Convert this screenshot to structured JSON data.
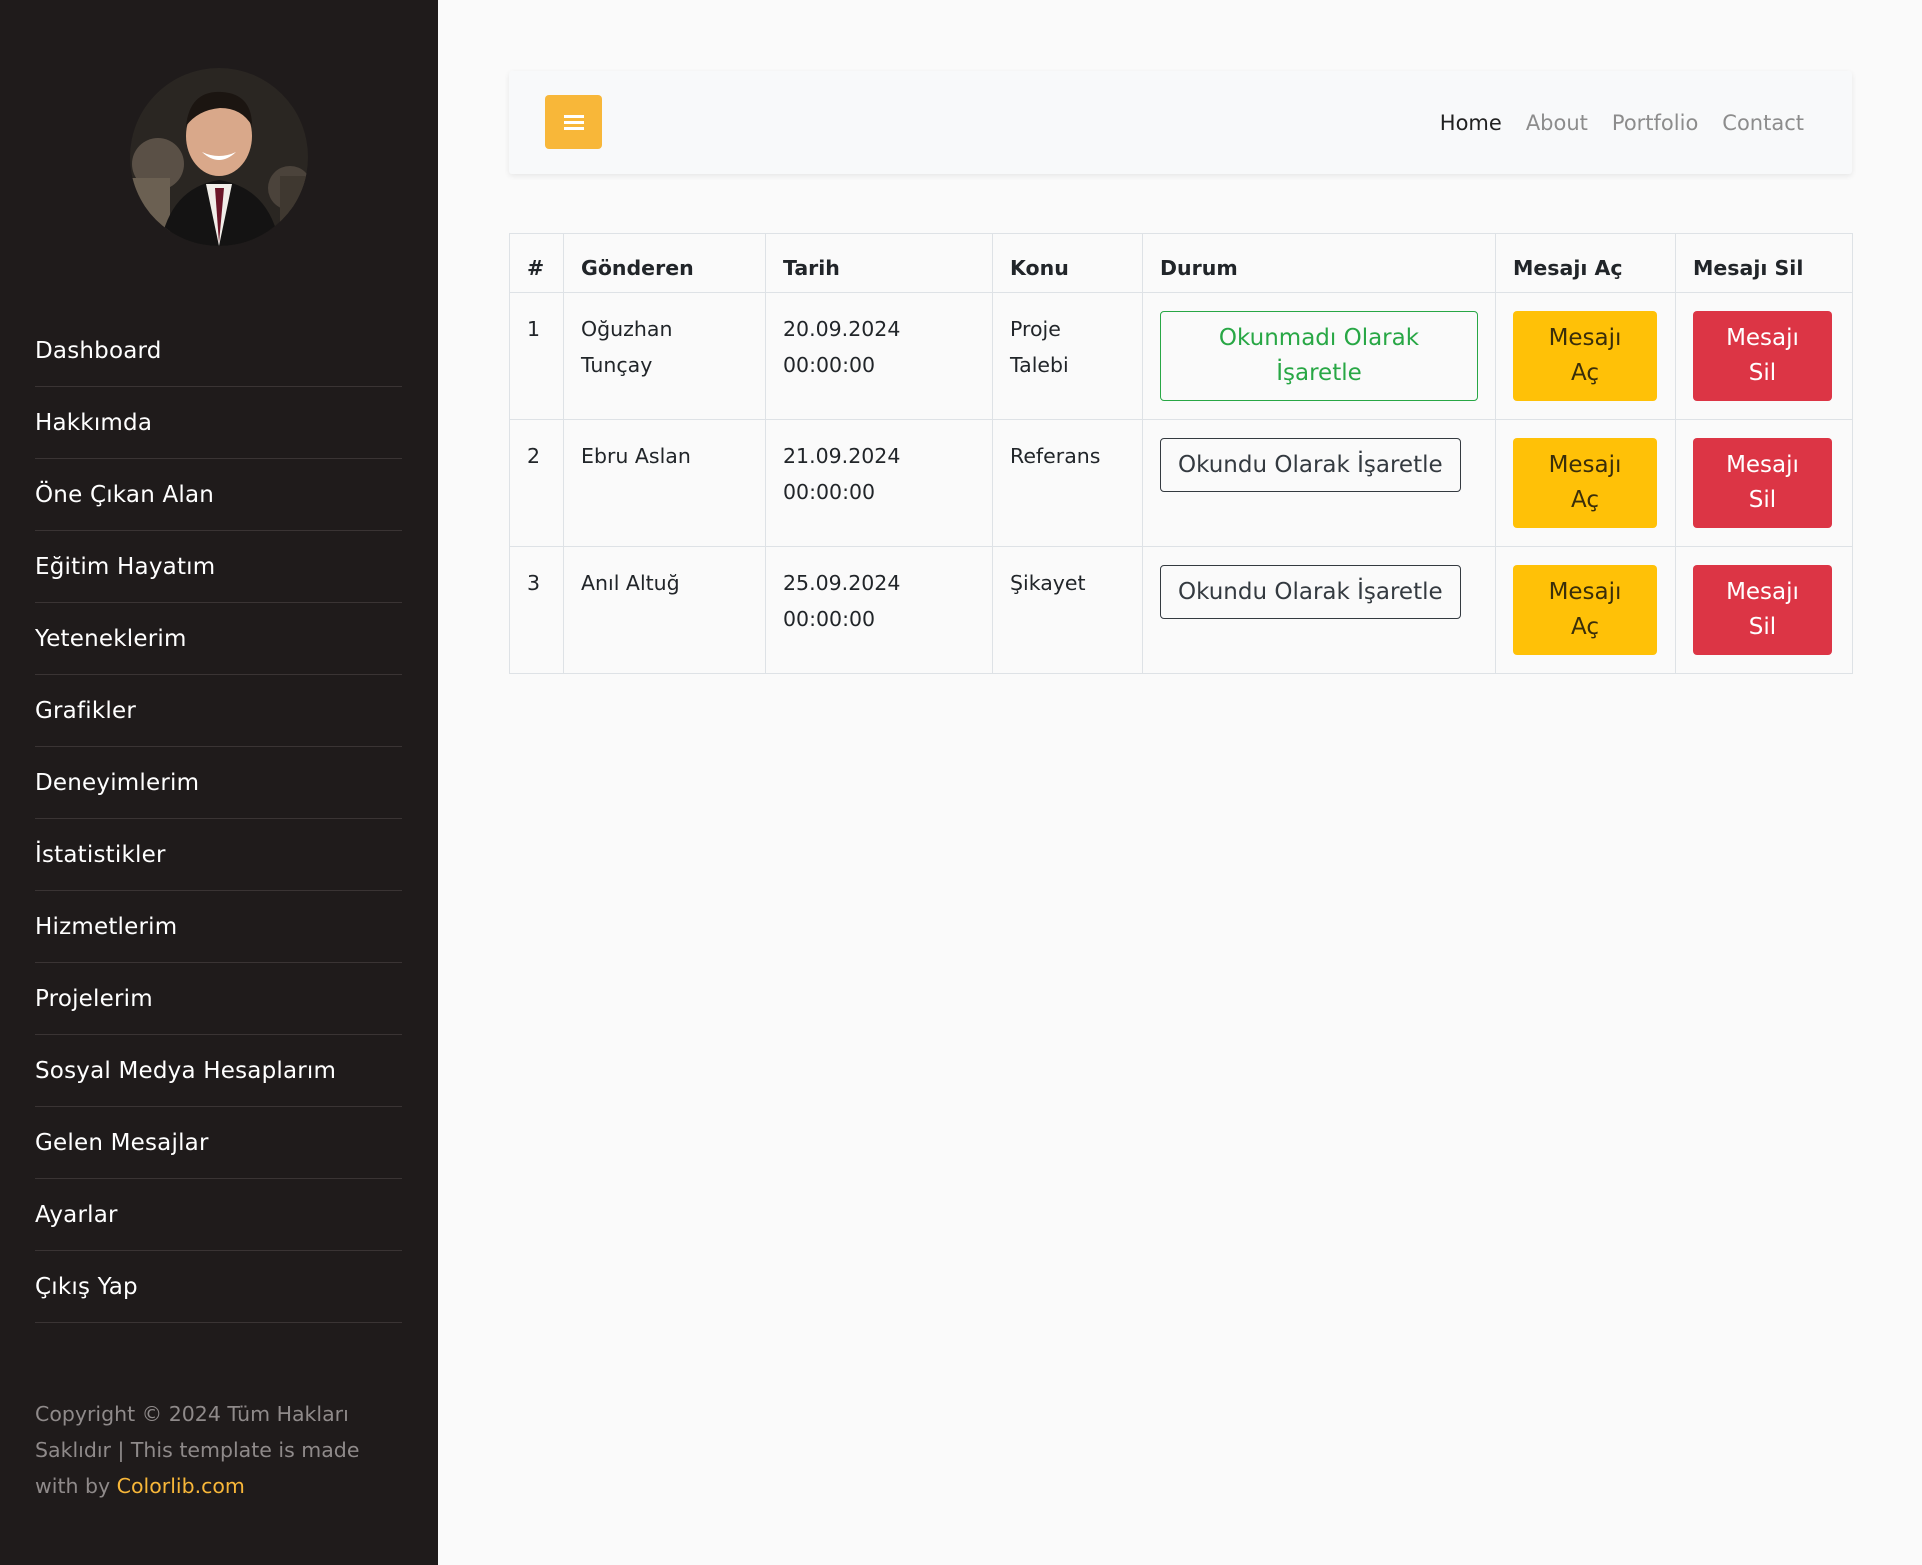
{
  "sidebar": {
    "menu": [
      {
        "label": "Dashboard"
      },
      {
        "label": "Hakkımda"
      },
      {
        "label": "Öne Çıkan Alan"
      },
      {
        "label": "Eğitim Hayatım"
      },
      {
        "label": "Yeteneklerim"
      },
      {
        "label": "Grafikler"
      },
      {
        "label": "Deneyimlerim"
      },
      {
        "label": "İstatistikler"
      },
      {
        "label": "Hizmetlerim"
      },
      {
        "label": "Projelerim"
      },
      {
        "label": "Sosyal Medya Hesaplarım"
      },
      {
        "label": "Gelen Mesajlar"
      },
      {
        "label": "Ayarlar"
      },
      {
        "label": "Çıkış Yap"
      }
    ],
    "copyright_text": "Copyright © 2024 Tüm Hakları Saklıdır | This template is made with by ",
    "copyright_link": "Colorlib.com"
  },
  "navbar": {
    "toggle_icon": "hamburger-icon",
    "links": [
      "Home",
      "About",
      "Portfolio",
      "Contact"
    ],
    "active": "Home"
  },
  "table": {
    "headers": [
      "#",
      "Gönderen",
      "Tarih",
      "Konu",
      "Durum",
      "Mesajı Aç",
      "Mesajı Sil"
    ],
    "rows": [
      {
        "no": "1",
        "sender_line1": "Oğuzhan",
        "sender_line2": "Tunçay",
        "date": "20.09.2024",
        "time": "00:00:00",
        "topic_line1": "Proje",
        "topic_line2": "Talebi",
        "status_line1": "Okunmadı Olarak",
        "status_line2": "İşaretle",
        "open_line1": "Mesajı",
        "open_line2": "Aç",
        "delete_line1": "Mesajı",
        "delete_line2": "Sil"
      },
      {
        "no": "2",
        "sender_line1": "Ebru Aslan",
        "date": "21.09.2024",
        "time": "00:00:00",
        "topic_line1": "Referans",
        "status_line1": "Okundu Olarak İşaretle",
        "open_line1": "Mesajı",
        "open_line2": "Aç",
        "delete_line1": "Mesajı",
        "delete_line2": "Sil"
      },
      {
        "no": "3",
        "sender_line1": "Anıl Altuğ",
        "date": "25.09.2024",
        "time": "00:00:00",
        "topic_line1": "Şikayet",
        "status_line1": "Okundu Olarak İşaretle",
        "open_line1": "Mesajı",
        "open_line2": "Aç",
        "delete_line1": "Mesajı",
        "delete_line2": "Sil"
      }
    ]
  },
  "colors": {
    "sidebar_bg": "#1f1b1b",
    "accent": "#f8b739",
    "success": "#28a745",
    "warning": "#ffc107",
    "danger": "#dc3545",
    "topic_orange": "#f26d21",
    "topic_cyan": "#2aaac9",
    "topic_red": "#e8121e"
  }
}
